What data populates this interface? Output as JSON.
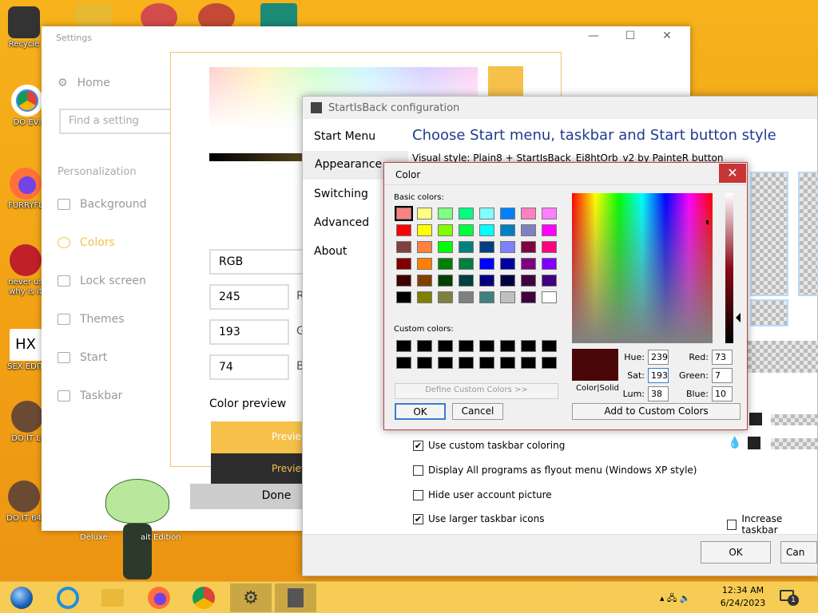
{
  "desktop": {
    "icons": [
      "Recycle",
      "DO EVI",
      "FURRYFL",
      "never us why is it",
      "SEX EDIT",
      "DO IT LI",
      "DO IT 64"
    ],
    "mascot_labels": [
      "Deluxe",
      "ait Edition"
    ]
  },
  "settings": {
    "title": "Settings",
    "controls": {
      "minimize": "—",
      "maximize": "☐",
      "close": "✕"
    },
    "home": "Home",
    "search_placeholder": "Find a setting",
    "section": "Personalization",
    "nav": [
      "Background",
      "Colors",
      "Lock screen",
      "Themes",
      "Start",
      "Taskbar"
    ],
    "mode": "RGB",
    "r": "245",
    "g": "193",
    "b": "74",
    "r_label": "R",
    "g_label": "G",
    "b_label": "B",
    "color_preview_label": "Color preview",
    "preview_text": "Preview",
    "done": "Done"
  },
  "startisback": {
    "title": "StartIsBack configuration",
    "nav": [
      "Start Menu",
      "Appearance",
      "Switching",
      "Advanced",
      "About"
    ],
    "heading": "Choose Start menu, taskbar and Start button style",
    "visual_style": "Visual style:  Plain8 + StartIsBack_Ei8htOrb_v2  by  PainteR button",
    "options": [
      {
        "label": "Use custom taskbar coloring",
        "checked": "✔"
      },
      {
        "label": "Display All programs as flyout menu (Windows XP style)",
        "checked": ""
      },
      {
        "label": "Hide user account picture",
        "checked": ""
      },
      {
        "label": "Use larger taskbar icons",
        "checked": "✔"
      }
    ],
    "increase_taskbar": "Increase taskbar",
    "ok": "OK",
    "cancel": "Can"
  },
  "color_dialog": {
    "title": "Color",
    "close": "✕",
    "basic_colors_label": "Basic colors:",
    "basic_colors": [
      "#ff8080",
      "#ffff80",
      "#80ff80",
      "#00ff80",
      "#80ffff",
      "#0080ff",
      "#ff80c0",
      "#ff80ff",
      "#ff0000",
      "#ffff00",
      "#80ff00",
      "#00ff40",
      "#00ffff",
      "#0080c0",
      "#8080c0",
      "#ff00ff",
      "#804040",
      "#ff8040",
      "#00ff00",
      "#008080",
      "#004080",
      "#8080ff",
      "#800040",
      "#ff0080",
      "#800000",
      "#ff8000",
      "#008000",
      "#008040",
      "#0000ff",
      "#0000a0",
      "#800080",
      "#8000ff",
      "#400000",
      "#804000",
      "#004000",
      "#004040",
      "#000080",
      "#000040",
      "#400040",
      "#400080",
      "#000000",
      "#808000",
      "#808040",
      "#808080",
      "#408080",
      "#c0c0c0",
      "#400040",
      "#ffffff"
    ],
    "custom_colors_label": "Custom colors:",
    "define_custom": "Define Custom Colors >>",
    "ok": "OK",
    "cancel": "Cancel",
    "color_solid": "Color|Solid",
    "hue_label": "Hue:",
    "hue": "239",
    "sat_label": "Sat:",
    "sat": "193",
    "lum_label": "Lum:",
    "lum": "38",
    "red_label": "Red:",
    "red": "73",
    "green_label": "Green:",
    "green": "7",
    "blue_label": "Blue:",
    "blue": "10",
    "add_custom": "Add to Custom Colors"
  },
  "taskbar": {
    "time": "12:34 AM",
    "date": "6/24/2023",
    "tray_glyphs": "▴  🖧  🔈",
    "notification_count": "1"
  }
}
